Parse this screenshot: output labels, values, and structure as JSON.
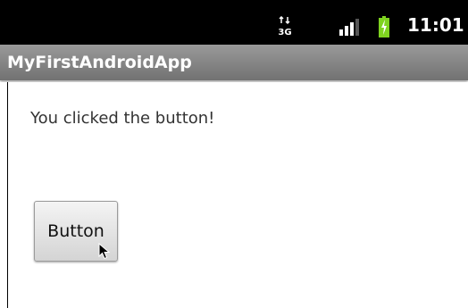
{
  "status_bar": {
    "time": "11:01",
    "network_icon": "3g-data-icon",
    "signal_icon": "signal-strength-icon",
    "battery_icon": "battery-charging-icon",
    "network_label": "3G"
  },
  "app": {
    "title": "MyFirstAndroidApp"
  },
  "main": {
    "message": "You clicked the button!",
    "button_label": "Button"
  },
  "colors": {
    "status_bar_bg": "#000000",
    "title_bar_bg": "#8a8a8a",
    "battery_green": "#7fd320"
  }
}
